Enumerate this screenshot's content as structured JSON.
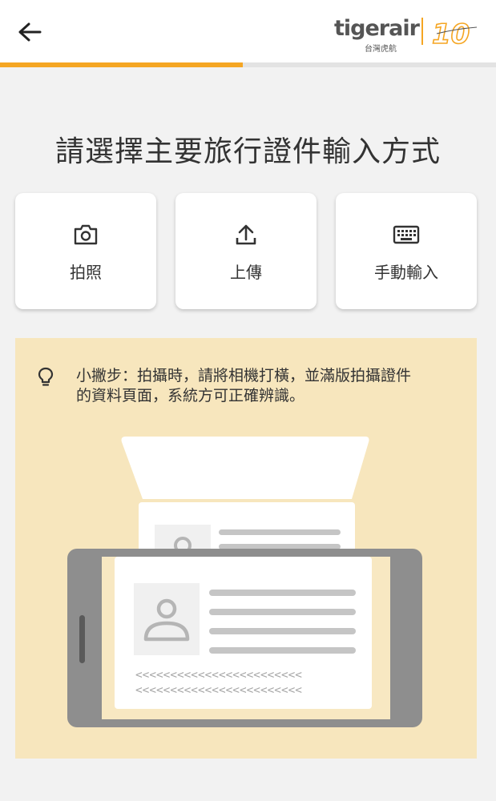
{
  "header": {
    "back_icon": "arrow-left-icon",
    "logo": {
      "brand": "tigerair",
      "subtitle": "台灣虎航",
      "anniversary": "10",
      "colors": {
        "accent": "#f5a623",
        "text": "#555555"
      }
    }
  },
  "progress": {
    "fraction": 0.49,
    "color": "#f5a623",
    "track": "#e3e3e3"
  },
  "page_title": "請選擇主要旅行證件輸入方式",
  "options": [
    {
      "label": "拍照",
      "icon": "camera-icon"
    },
    {
      "label": "上傳",
      "icon": "upload-icon"
    },
    {
      "label": "手動輸入",
      "icon": "keyboard-icon"
    }
  ],
  "tip": {
    "icon": "lightbulb-icon",
    "lines": [
      "小撇步：拍攝時，請將相機打橫，並滿版拍攝證件",
      "的資料頁面，系統方可正確辨識。"
    ],
    "background": "#f7e6bd"
  },
  "illustration": {
    "name": "phone-scanning-passport",
    "mrz_line": "<<<<<<<<<<<<<<<<<<<<<<<<"
  }
}
